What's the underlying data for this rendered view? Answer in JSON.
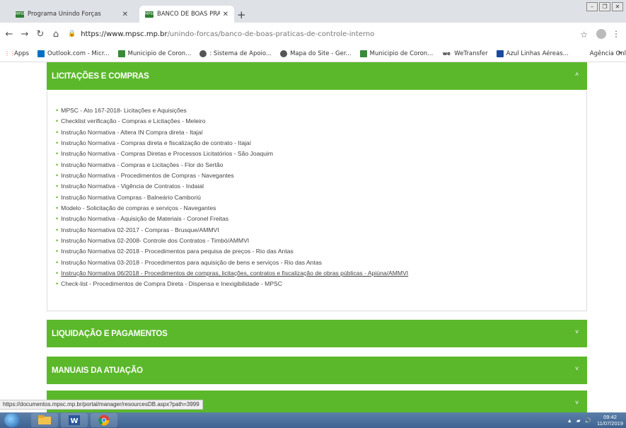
{
  "tabs": [
    {
      "label": "Programa Unindo Forças",
      "favicon": "mpsc-favicon"
    },
    {
      "label": "BANCO DE BOAS PRÁTICAS DE C",
      "favicon": "mpsc-favicon"
    }
  ],
  "new_tab": "+",
  "url": {
    "host": "https://www.mpsc.mp.br",
    "path": "/unindo-forcas/banco-de-boas-praticas-de-controle-interno"
  },
  "bookmarks": [
    {
      "label": "Apps",
      "icon": "apps-grid-icon",
      "color": "#e8453c"
    },
    {
      "label": "Outlook.com - Micr...",
      "icon": "outlook-icon",
      "color": "#0072c6"
    },
    {
      "label": "Municipio de Coron...",
      "icon": "municipio-crest-icon",
      "color": "#3a8a3a"
    },
    {
      "label": ": Sistema de Apoio...",
      "icon": "globe-icon",
      "color": "#555555"
    },
    {
      "label": "Mapa do Site - Ger...",
      "icon": "globe-icon",
      "color": "#555555"
    },
    {
      "label": "Municipio de Coron...",
      "icon": "municipio-crest-icon",
      "color": "#3a8a3a"
    },
    {
      "label": "WeTransfer",
      "icon": "wetransfer-icon",
      "color": "#222222"
    },
    {
      "label": "Azul Linhas Aéreas...",
      "icon": "azul-icon",
      "color": "#1a4a9e"
    },
    {
      "label": "Agência Online",
      "icon": "",
      "color": ""
    }
  ],
  "bookmarks_more": "»",
  "sections": [
    {
      "title": "LICITAÇÕES E COMPRAS",
      "chevron": "^"
    },
    {
      "title": "LIQUIDAÇÃO E PAGAMENTOS",
      "chevron": "v"
    },
    {
      "title": "MANUAIS DA ATUAÇÃO",
      "chevron": "v"
    },
    {
      "title": "",
      "chevron": "v"
    }
  ],
  "items": [
    "MPSC - Ato 167-2018- Licitações e Aquisições",
    "Checklist verificação - Compras e Licitações - Meleiro",
    "Instrução Normativa - Altera IN Compra direta - Itajaí",
    "Instrução Normativa - Compras direta e fiscalização de contrato - Itajaí",
    "Instrução Normativa - Compras Diretas e Processos Licitatórios - São Joaquim",
    "Instrução Normativa - Compras e Licitações - Flor do Sertão",
    "Instrução Normativa - Procedimentos de Compras - Navegantes",
    "Instrução Normativa - Vigência de Contratos - Indaial",
    "Instrução Normativa Compras - Balneário Camboriú",
    "Modelo - Solicitação de compras e serviços - Navegantes",
    "Instrução Normativa - Aquisição de Materiais - Coronel Freitas",
    "Instrução Normativa 02-2017 - Compras - Brusque/AMMVI",
    "Instrução Normativa 02-2008- Controle dos Contratos - Timbó/AMMVI",
    "Instrução Normativa 02-2018 - Procedimentos para pequisa de preços - Rio das Antas",
    "Instrução Normativa 03-2018 - Procedimentos para aquisição de bens e serviços - Rio das Antas",
    "Instrução Normativa 06/2018 - Procedimentos de compras, licitações, contratos e fiscalização de obras públicas - Apiúna/AMMVI",
    "Check-list - Procedimentos de Compra Direta - Dispensa e Inexigibilidade - MPSC"
  ],
  "hovered_item_index": 15,
  "status_url": "https://documentos.mpsc.mp.br/portal/manager/resourcesDB.aspx?path=3999",
  "clock": {
    "time": "09:42",
    "date": "11/07/2019"
  },
  "colors": {
    "accent": "#5cb82b",
    "tabbar": "#dee1e6",
    "taskbar": "#3e6391"
  }
}
